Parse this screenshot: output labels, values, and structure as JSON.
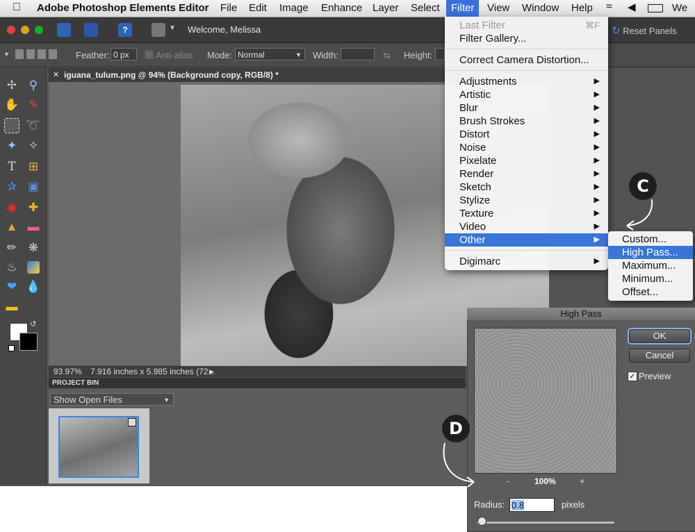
{
  "menubar": {
    "app_name": "Adobe Photoshop Elements Editor",
    "items": [
      "File",
      "Edit",
      "Image",
      "Enhance",
      "Layer",
      "Select",
      "Filter",
      "View",
      "Window",
      "Help"
    ],
    "right_text": "We"
  },
  "topbar": {
    "welcome": "Welcome, Melissa",
    "reset_panels": "Reset Panels"
  },
  "options": {
    "feather_label": "Feather:",
    "feather_value": "0 px",
    "antialias_label": "Anti-alias",
    "mode_label": "Mode:",
    "mode_value": "Normal",
    "width_label": "Width:",
    "height_label": "Height:"
  },
  "document": {
    "tab_title": "iguana_tulum.png @ 94% (Background copy, RGB/8) *",
    "zoom": "93.97%",
    "size_info": "7.916 inches x 5.985 inches (72..."
  },
  "project_bin": {
    "title": "PROJECT BIN",
    "select_value": "Show Open Files"
  },
  "filter_menu": {
    "last_filter": "Last Filter",
    "last_filter_shortcut": "⌘F",
    "filter_gallery": "Filter Gallery...",
    "correct_camera": "Correct Camera Distortion...",
    "items": [
      "Adjustments",
      "Artistic",
      "Blur",
      "Brush Strokes",
      "Distort",
      "Noise",
      "Pixelate",
      "Render",
      "Sketch",
      "Stylize",
      "Texture",
      "Video",
      "Other"
    ],
    "digimarc": "Digimarc"
  },
  "other_submenu": {
    "items": [
      "Custom...",
      "High Pass...",
      "Maximum...",
      "Minimum...",
      "Offset..."
    ]
  },
  "high_pass": {
    "title": "High Pass",
    "ok": "OK",
    "cancel": "Cancel",
    "preview": "Preview",
    "zoom_minus": "-",
    "zoom": "100%",
    "zoom_plus": "+",
    "radius_label": "Radius:",
    "radius_value": "0.8",
    "radius_unit": "pixels"
  },
  "callouts": {
    "c": "C",
    "d": "D"
  },
  "colors": {
    "menu_highlight": "#3875d7",
    "accent_blue": "#3b83e6"
  }
}
